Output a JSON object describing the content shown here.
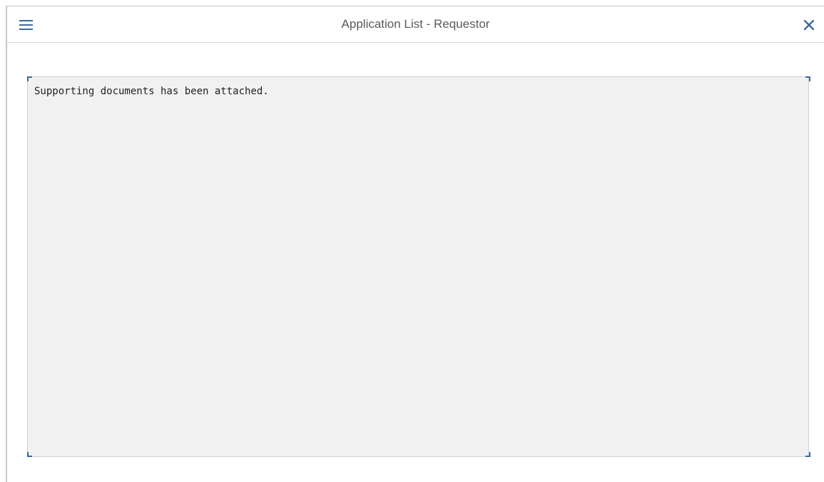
{
  "header": {
    "title": "Application List - Requestor",
    "menu_icon": "hamburger-menu-icon",
    "close_icon": "close-icon"
  },
  "main": {
    "text_content": "Supporting documents has been attached."
  },
  "colors": {
    "accent": "#3b6a9c",
    "title_text": "#5a5a5a",
    "text_area_bg": "#f1f1f1"
  }
}
